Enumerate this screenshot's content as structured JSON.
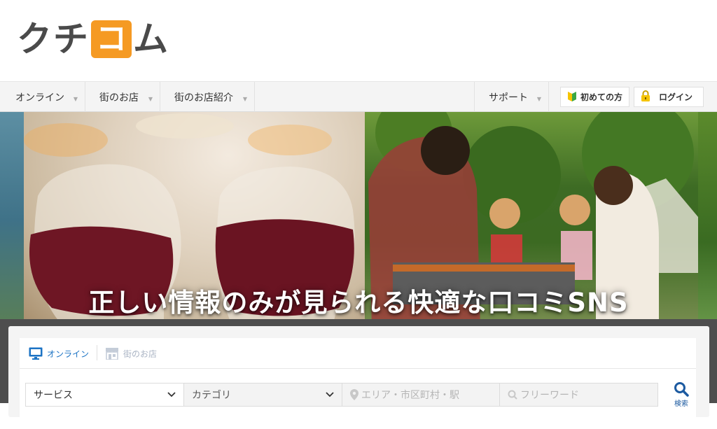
{
  "header": {
    "logo_chars": [
      "ク",
      "チ",
      "コ",
      "ム"
    ],
    "logo_accent_color": "#f59a23"
  },
  "nav": {
    "items": [
      {
        "label": "オンライン"
      },
      {
        "label": "街のお店"
      },
      {
        "label": "街のお店紹介"
      }
    ],
    "support_label": "サポート",
    "beginner_label": "初めての方",
    "login_label": "ログイン"
  },
  "hero": {
    "title": "正しい情報のみが見られる快適な口コミSNS"
  },
  "search": {
    "tabs": [
      {
        "label": "オンライン",
        "icon": "monitor-icon",
        "active": true
      },
      {
        "label": "街のお店",
        "icon": "storefront-icon",
        "active": false
      }
    ],
    "service_value": "サービス",
    "category_value": "カテゴリ",
    "area_placeholder": "エリア・市区町村・駅",
    "keyword_placeholder": "フリーワード",
    "search_label": "検索",
    "accent_color": "#1c73c4"
  }
}
